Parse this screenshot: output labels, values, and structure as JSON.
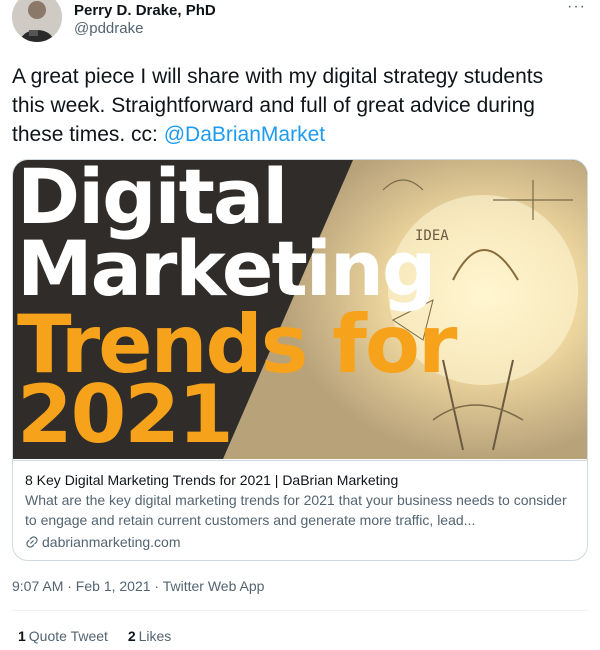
{
  "author": {
    "name": "Perry D. Drake, PhD",
    "handle": "@pddrake"
  },
  "tweet": {
    "text": "A great piece I will share with my digital strategy students this week.  Straightforward and full of great advice during these times.  cc: ",
    "mention": "@DaBrianMarket"
  },
  "card": {
    "image_lines": [
      "Digital",
      "Marketing",
      "Trends for",
      "2021"
    ],
    "image_colors": {
      "white": "#ffffff",
      "orange": "#f7a21b",
      "background": "#2f2c2a"
    },
    "title": "8 Key Digital Marketing Trends for 2021 | DaBrian Marketing",
    "description": "What are the key digital marketing trends for 2021 that your business needs to consider to engage and retain current customers and generate more traffic, lead...",
    "domain": "dabrianmarketing.com",
    "domain_icon": "link-icon"
  },
  "meta": {
    "timestamp": "9:07 AM · Feb 1, 2021 · Twitter Web App"
  },
  "stats": {
    "quote_count": "1",
    "quote_label": "Quote Tweet",
    "like_count": "2",
    "like_label": "Likes"
  },
  "icons": {
    "more": "more-icon"
  },
  "colors": {
    "link": "#1d9bf0",
    "secondary_text": "#536471"
  }
}
